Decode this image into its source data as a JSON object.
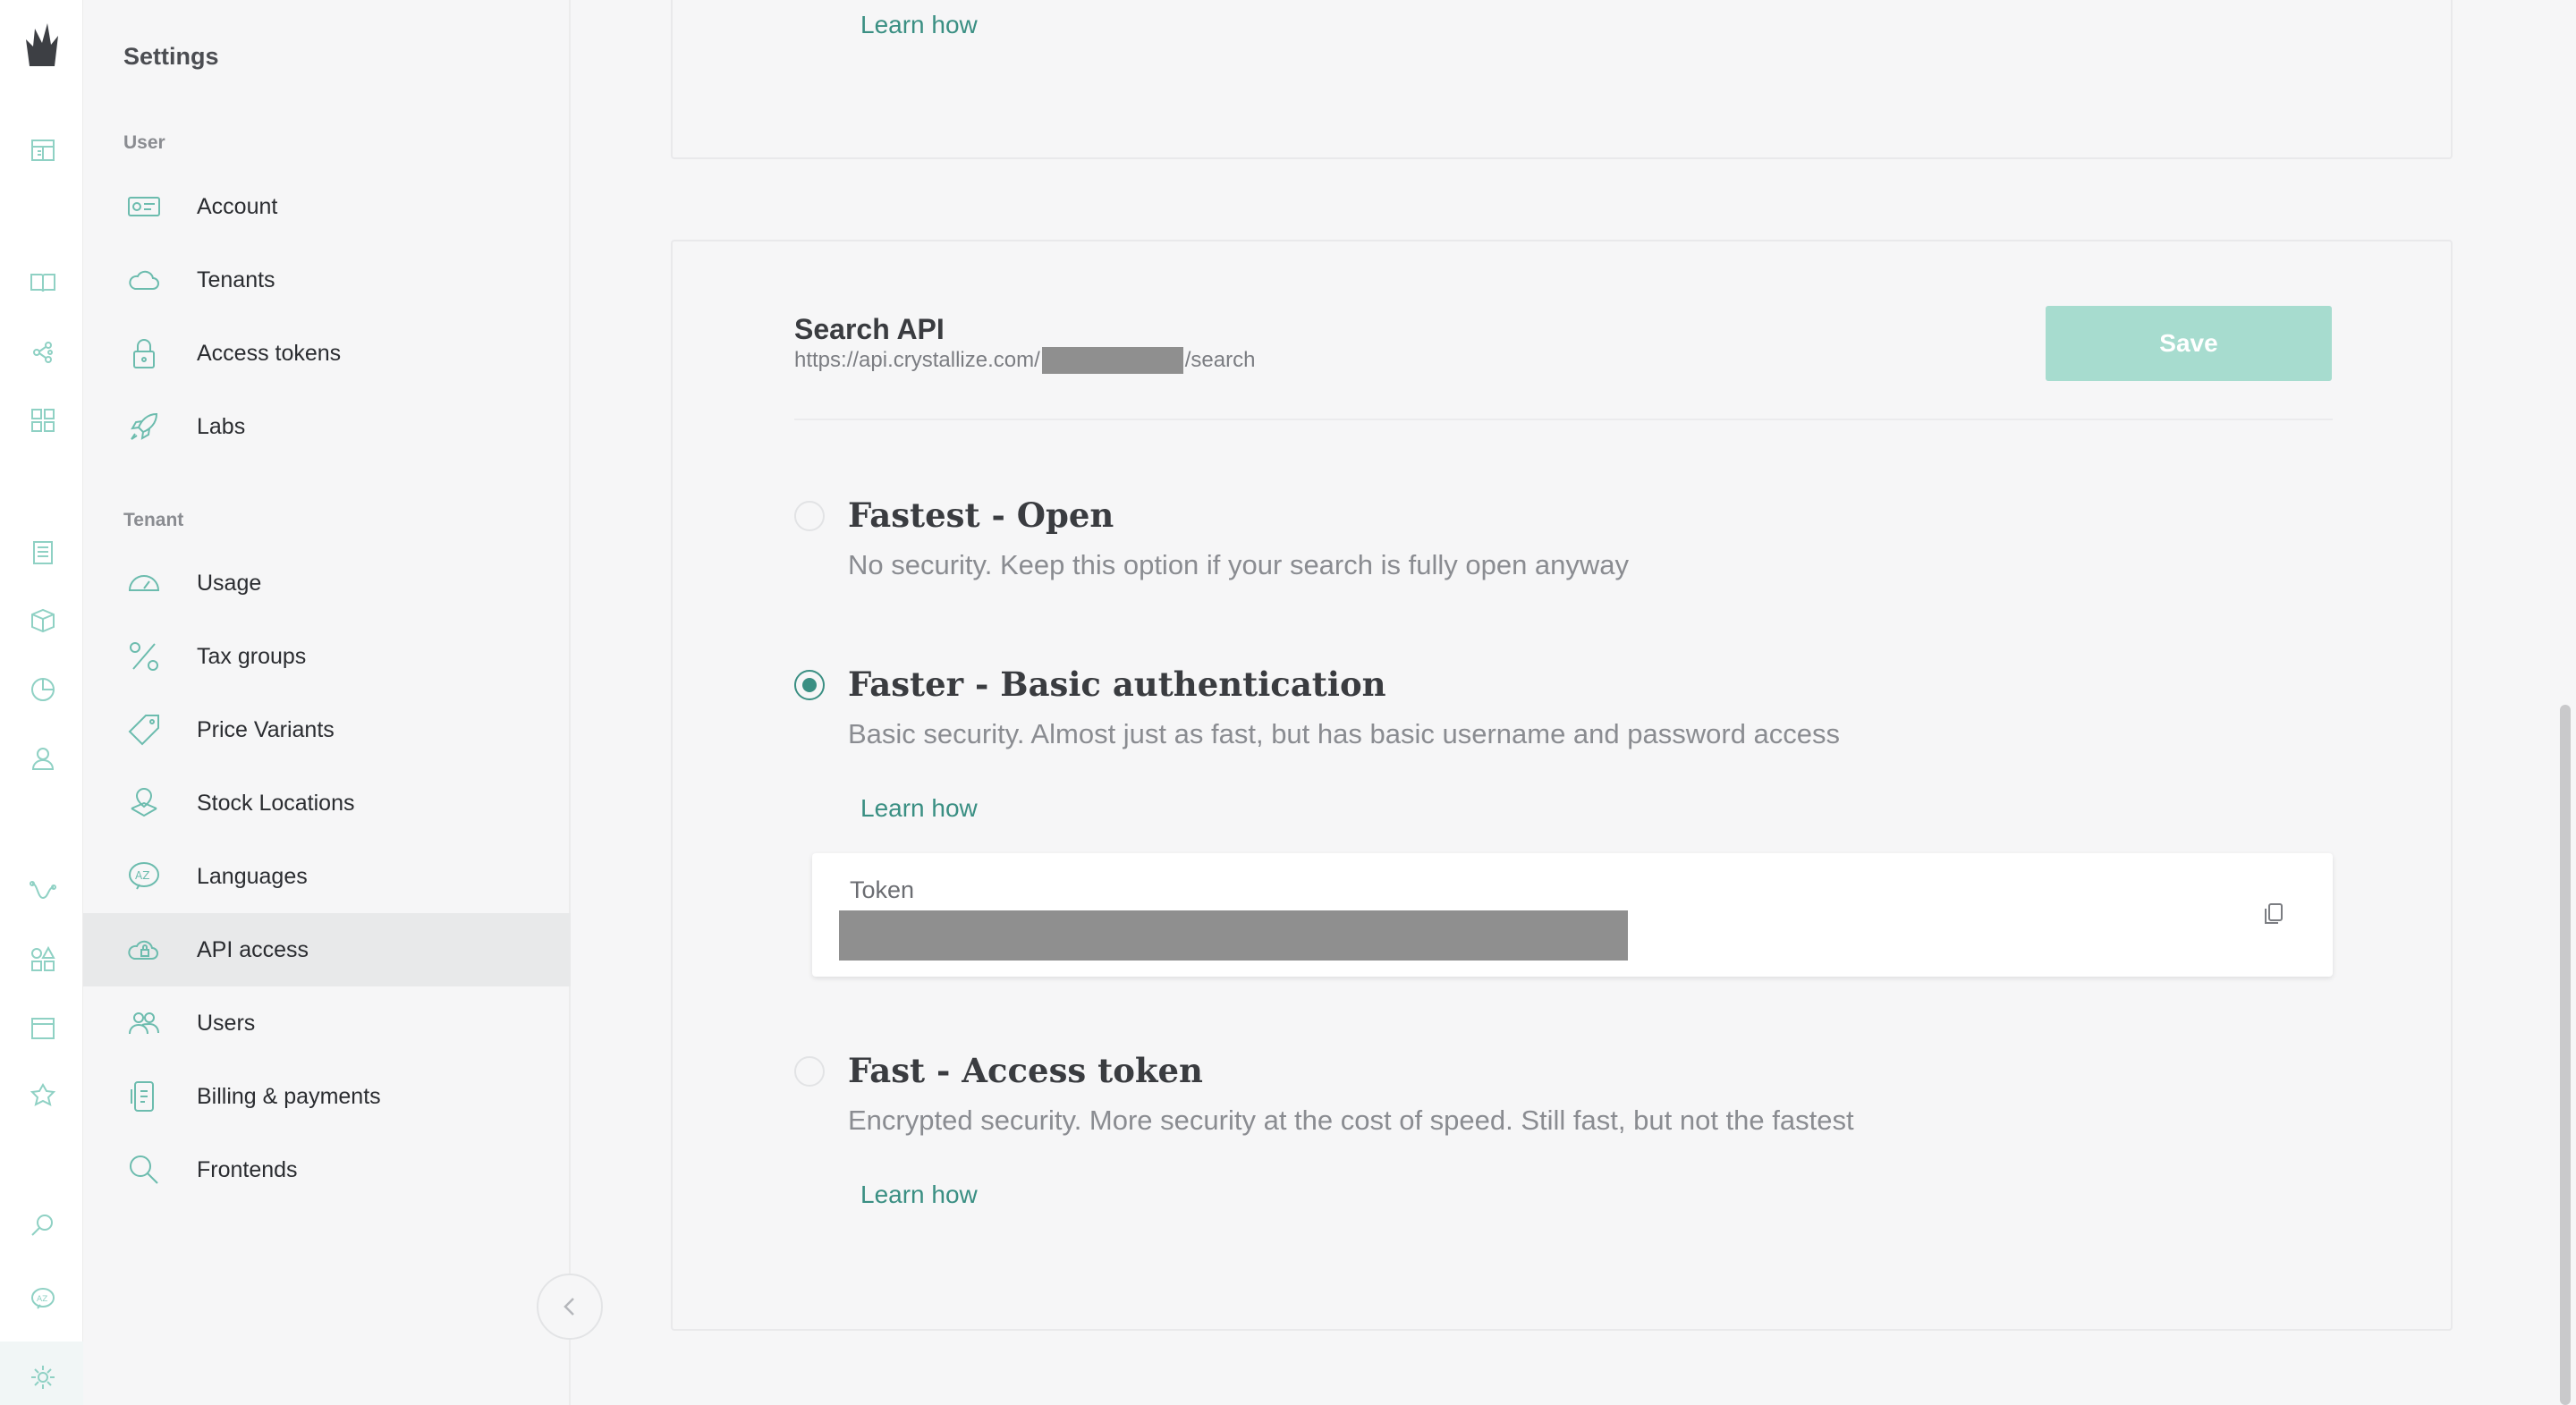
{
  "rail": {
    "icons": [
      "crystallize-logo-icon",
      "dashboard-icon",
      "catalogue-icon",
      "topics-icon",
      "grid-icon",
      "orders-icon",
      "products-icon",
      "analytics-icon",
      "customers-icon",
      "flows-icon",
      "shapes-icon",
      "pages-icon",
      "marketplace-icon",
      "search-icon",
      "languages-icon",
      "settings-icon"
    ]
  },
  "sidebar": {
    "title": "Settings",
    "user_group": "User",
    "tenant_group": "Tenant",
    "user_items": [
      {
        "label": "Account",
        "icon": "account-card-icon"
      },
      {
        "label": "Tenants",
        "icon": "cloud-icon"
      },
      {
        "label": "Access tokens",
        "icon": "lock-icon"
      },
      {
        "label": "Labs",
        "icon": "rocket-icon"
      }
    ],
    "tenant_items": [
      {
        "label": "Usage",
        "icon": "gauge-icon"
      },
      {
        "label": "Tax groups",
        "icon": "percent-icon"
      },
      {
        "label": "Price Variants",
        "icon": "price-tag-icon"
      },
      {
        "label": "Stock Locations",
        "icon": "stock-location-icon"
      },
      {
        "label": "Languages",
        "icon": "languages-bubble-icon"
      },
      {
        "label": "API access",
        "icon": "api-cloud-icon",
        "active": true
      },
      {
        "label": "Users",
        "icon": "users-icon"
      },
      {
        "label": "Billing & payments",
        "icon": "billing-icon"
      },
      {
        "label": "Frontends",
        "icon": "frontends-search-icon"
      }
    ]
  },
  "top_card": {
    "learn_how": "Learn how"
  },
  "search_api": {
    "title": "Search API",
    "url_prefix": "https://api.crystallize.com/",
    "url_suffix": "/search",
    "save_label": "Save",
    "options": [
      {
        "title": "Fastest - Open",
        "description": "No security. Keep this option if your search is fully open anyway",
        "selected": false
      },
      {
        "title": "Faster - Basic authentication",
        "description": "Basic security. Almost just as fast, but has basic username and password access",
        "selected": true,
        "learn_how": "Learn how"
      },
      {
        "title": "Fast - Access token",
        "description": "Encrypted security. More security at the cost of speed. Still fast, but not the fastest",
        "selected": false,
        "learn_how": "Learn how"
      }
    ],
    "token_label": "Token"
  },
  "colors": {
    "accent": "#3a8f83",
    "save_button": "#a7dccf",
    "redaction": "#8f8f8f"
  }
}
